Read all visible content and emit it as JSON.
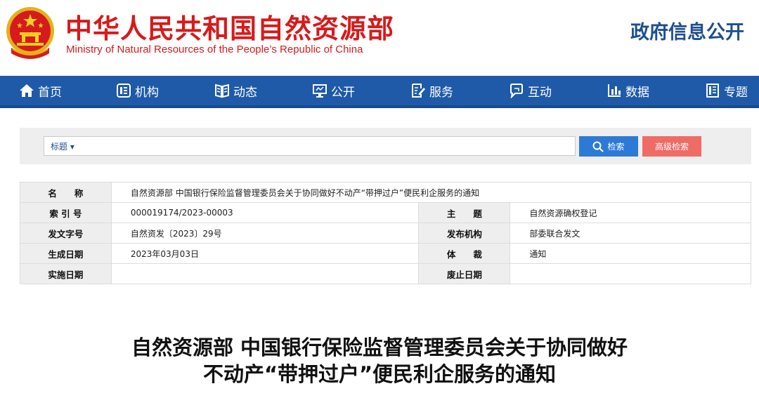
{
  "header": {
    "title_zh": "中华人民共和国自然资源部",
    "title_en": "Ministry of Natural Resources of the People’s Republic of China",
    "gov_info": "政府信息公开"
  },
  "nav": {
    "items": [
      {
        "label": "首页",
        "icon": "home-icon"
      },
      {
        "label": "机构",
        "icon": "org-icon"
      },
      {
        "label": "动态",
        "icon": "book-icon"
      },
      {
        "label": "公开",
        "icon": "monitor-icon"
      },
      {
        "label": "服务",
        "icon": "document-edit-icon"
      },
      {
        "label": "互动",
        "icon": "chat-icon"
      },
      {
        "label": "数据",
        "icon": "bar-chart-icon"
      },
      {
        "label": "专题",
        "icon": "notebook-icon"
      }
    ]
  },
  "search": {
    "type_label": "标题 ▾",
    "placeholder": "",
    "search_button": "检索",
    "advanced_button": "高级检索"
  },
  "info": {
    "name_label": "名　　称",
    "name_value": "自然资源部 中国银行保险监督管理委员会关于协同做好不动产“带押过户”便民利企服务的通知",
    "index_label": "索 引 号",
    "index_value": "000019174/2023-00003",
    "subject_label": "主　　题",
    "subject_value": "自然资源确权登记",
    "docno_label": "发文字号",
    "docno_value": "自然资发〔2023〕29号",
    "issuer_label": "发布机构",
    "issuer_value": "部委联合发文",
    "created_label": "生成日期",
    "created_value": "2023年03月03日",
    "genre_label": "体　　裁",
    "genre_value": "通知",
    "effective_label": "实施日期",
    "effective_value": "",
    "expiry_label": "废止日期",
    "expiry_value": ""
  },
  "article": {
    "title_line1": "自然资源部 中国银行保险监督管理委员会关于协同做好",
    "title_line2": "不动产“带押过户”便民利企服务的通知"
  },
  "colors": {
    "brand_red": "#d71a1b",
    "nav_blue": "#1e5aa8",
    "search_blue": "#2d7ad6",
    "advanced_red": "#ef6b66"
  }
}
